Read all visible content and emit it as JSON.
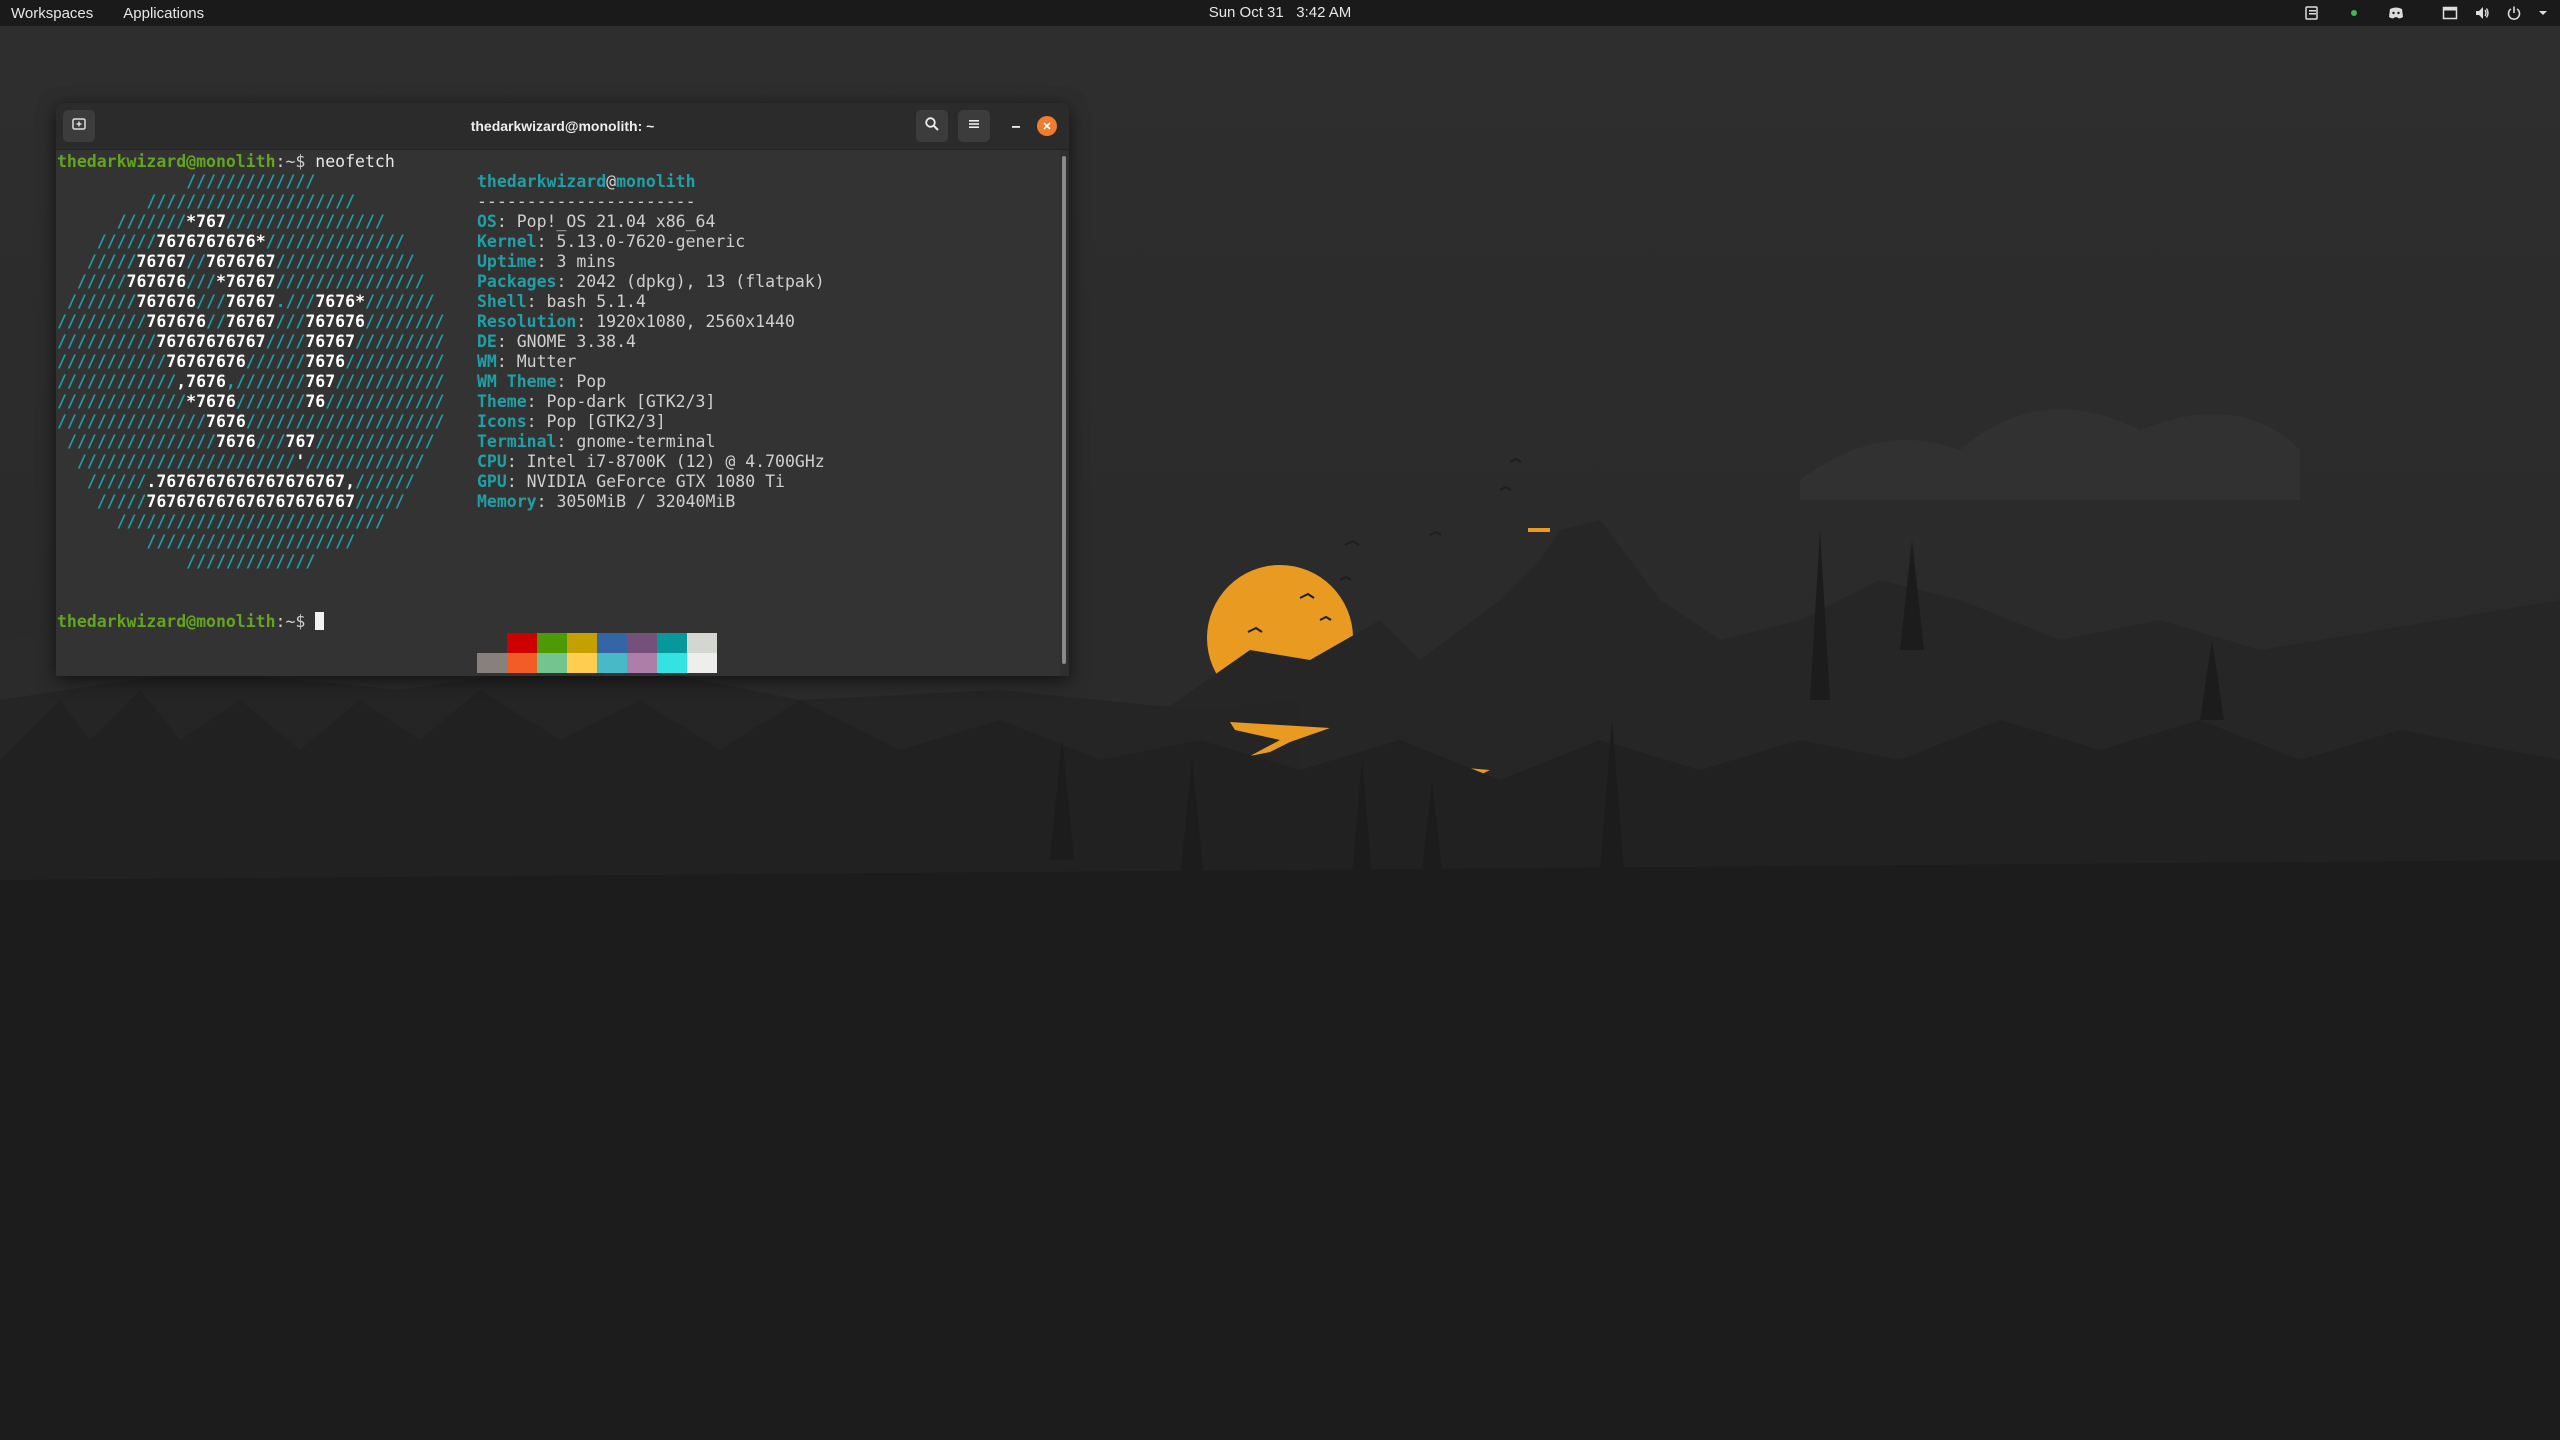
{
  "topbar": {
    "workspaces": "Workspaces",
    "applications": "Applications",
    "date": "Sun Oct 31",
    "time": "3:42 AM",
    "tray_icons": [
      "clipboard-icon",
      "status-dot-icon",
      "discord-icon",
      "window-icon",
      "volume-icon",
      "power-icon",
      "chevron-down-icon"
    ]
  },
  "terminal": {
    "title": "thedarkwizard@monolith: ~",
    "header_icons": [
      "new-tab-icon",
      "search-icon",
      "menu-icon",
      "minimize-icon",
      "close-icon"
    ],
    "prompt_user": "thedarkwizard@monolith",
    "prompt_path": ":~$ ",
    "command": "neofetch",
    "logo_lines": [
      [
        [
          "             ",
          "t"
        ],
        [
          "/////////////",
          "c"
        ]
      ],
      [
        [
          "         ",
          "t"
        ],
        [
          "/////////////////////",
          "c"
        ]
      ],
      [
        [
          "      ",
          "t"
        ],
        [
          "///////",
          "c"
        ],
        [
          "*767",
          "w"
        ],
        [
          "////////////////",
          "c"
        ]
      ],
      [
        [
          "    ",
          "t"
        ],
        [
          "//////",
          "c"
        ],
        [
          "7676767676*",
          "w"
        ],
        [
          "//////////////",
          "c"
        ]
      ],
      [
        [
          "   ",
          "t"
        ],
        [
          "/////",
          "c"
        ],
        [
          "76767",
          "w"
        ],
        [
          "//",
          "c"
        ],
        [
          "7676767",
          "w"
        ],
        [
          "//////////////",
          "c"
        ]
      ],
      [
        [
          "  ",
          "t"
        ],
        [
          "/////",
          "c"
        ],
        [
          "767676",
          "w"
        ],
        [
          "///",
          "c"
        ],
        [
          "*76767",
          "w"
        ],
        [
          "///////////////",
          "c"
        ]
      ],
      [
        [
          " ",
          "t"
        ],
        [
          "///////",
          "c"
        ],
        [
          "767676",
          "w"
        ],
        [
          "///",
          "c"
        ],
        [
          "76767",
          "w"
        ],
        [
          ".///",
          "c"
        ],
        [
          "7676*",
          "w"
        ],
        [
          "///////",
          "c"
        ]
      ],
      [
        [
          "/////////",
          "c"
        ],
        [
          "767676",
          "w"
        ],
        [
          "//",
          "c"
        ],
        [
          "76767",
          "w"
        ],
        [
          "///",
          "c"
        ],
        [
          "767676",
          "w"
        ],
        [
          "////////",
          "c"
        ]
      ],
      [
        [
          "//////////",
          "c"
        ],
        [
          "76767676767",
          "w"
        ],
        [
          "////",
          "c"
        ],
        [
          "76767",
          "w"
        ],
        [
          "/////////",
          "c"
        ]
      ],
      [
        [
          "///////////",
          "c"
        ],
        [
          "76767676",
          "w"
        ],
        [
          "//////",
          "c"
        ],
        [
          "7676",
          "w"
        ],
        [
          "//////////",
          "c"
        ]
      ],
      [
        [
          "////////////",
          "c"
        ],
        [
          ",7676",
          "w"
        ],
        [
          ",///////",
          "c"
        ],
        [
          "767",
          "w"
        ],
        [
          "///////////",
          "c"
        ]
      ],
      [
        [
          "/////////////",
          "c"
        ],
        [
          "*7676",
          "w"
        ],
        [
          "///////",
          "c"
        ],
        [
          "76",
          "w"
        ],
        [
          "////////////",
          "c"
        ]
      ],
      [
        [
          "///////////////",
          "c"
        ],
        [
          "7676",
          "w"
        ],
        [
          "////////////////////",
          "c"
        ]
      ],
      [
        [
          " ",
          "t"
        ],
        [
          "///////////////",
          "c"
        ],
        [
          "7676",
          "w"
        ],
        [
          "///",
          "c"
        ],
        [
          "767",
          "w"
        ],
        [
          "////////////",
          "c"
        ]
      ],
      [
        [
          "  ",
          "t"
        ],
        [
          "//////////////////////",
          "c"
        ],
        [
          "'",
          "w"
        ],
        [
          "////////////",
          "c"
        ]
      ],
      [
        [
          "   ",
          "t"
        ],
        [
          "//////",
          "c"
        ],
        [
          ".7676767676767676767,",
          "w"
        ],
        [
          "//////",
          "c"
        ]
      ],
      [
        [
          "    ",
          "t"
        ],
        [
          "/////",
          "c"
        ],
        [
          "767676767676767676767",
          "w"
        ],
        [
          "/////",
          "c"
        ]
      ],
      [
        [
          "      ",
          "t"
        ],
        [
          "///////////////////////////",
          "c"
        ]
      ],
      [
        [
          "         ",
          "t"
        ],
        [
          "/////////////////////",
          "c"
        ]
      ],
      [
        [
          "             ",
          "t"
        ],
        [
          "/////////////",
          "c"
        ]
      ]
    ],
    "info_user": "thedarkwizard",
    "info_at": "@",
    "info_host": "monolith",
    "separator": "----------------------",
    "info": [
      {
        "key": "OS",
        "value": ": Pop!_OS 21.04 x86_64"
      },
      {
        "key": "Kernel",
        "value": ": 5.13.0-7620-generic"
      },
      {
        "key": "Uptime",
        "value": ": 3 mins"
      },
      {
        "key": "Packages",
        "value": ": 2042 (dpkg), 13 (flatpak)"
      },
      {
        "key": "Shell",
        "value": ": bash 5.1.4"
      },
      {
        "key": "Resolution",
        "value": ": 1920x1080, 2560x1440"
      },
      {
        "key": "DE",
        "value": ": GNOME 3.38.4"
      },
      {
        "key": "WM",
        "value": ": Mutter"
      },
      {
        "key": "WM Theme",
        "value": ": Pop"
      },
      {
        "key": "Theme",
        "value": ": Pop-dark [GTK2/3]"
      },
      {
        "key": "Icons",
        "value": ": Pop [GTK2/3]"
      },
      {
        "key": "Terminal",
        "value": ": gnome-terminal"
      },
      {
        "key": "CPU",
        "value": ": Intel i7-8700K (12) @ 4.700GHz"
      },
      {
        "key": "GPU",
        "value": ": NVIDIA GeForce GTX 1080 Ti"
      },
      {
        "key": "Memory",
        "value": ": 3050MiB / 32040MiB"
      }
    ],
    "palette_top": [
      "#333333",
      "#cc0000",
      "#4e9a06",
      "#c4a000",
      "#3465a4",
      "#75507b",
      "#06989a",
      "#d3d7cf"
    ],
    "palette_bottom": [
      "#88807c",
      "#f15d22",
      "#73c48f",
      "#ffce51",
      "#48b9c7",
      "#ad7fa8",
      "#34e2e2",
      "#eeeeec"
    ]
  },
  "colors": {
    "accent_orange": "#f07c2e",
    "prompt_green": "#63a51d",
    "neofetch_teal": "#1fa0a7",
    "sun_orange": "#e89b20"
  }
}
